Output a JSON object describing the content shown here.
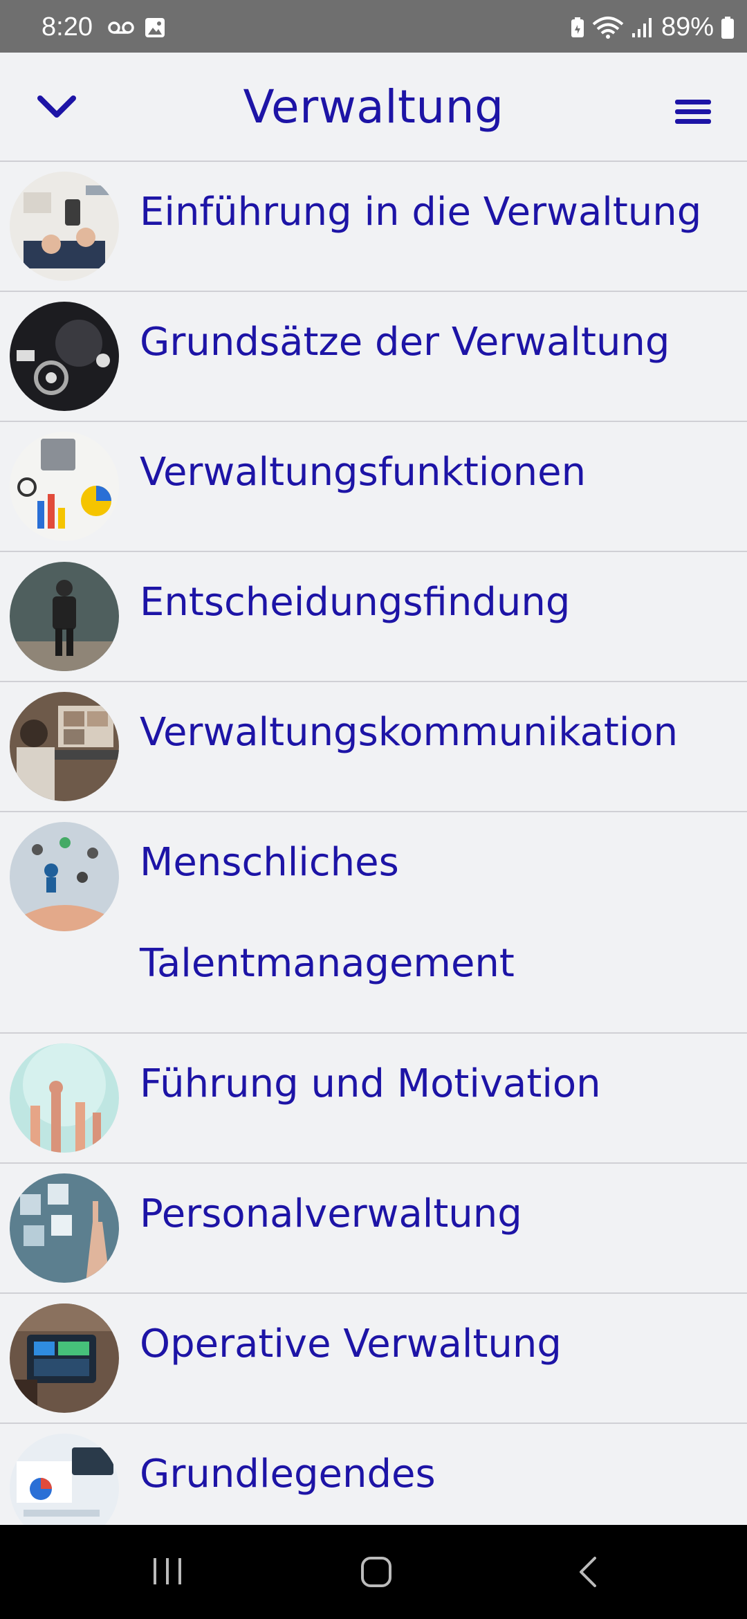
{
  "status_bar": {
    "time": "8:20",
    "battery": "89%",
    "icons": [
      "voicemail-icon",
      "image-icon",
      "battery-saver-icon",
      "wifi-icon",
      "signal-icon",
      "battery-icon"
    ]
  },
  "header": {
    "title": "Verwaltung",
    "left_icon": "chevron-down-icon",
    "right_icon": "hamburger-menu-icon"
  },
  "colors": {
    "accent": "#1d14a6",
    "background": "#f1f2f4",
    "divider": "#d0d0d5"
  },
  "items": [
    {
      "label": "Einführung in die Verwaltung",
      "thumb": "office-desk-photo"
    },
    {
      "label": "Grundsätze der Verwaltung",
      "thumb": "gears-icons-photo"
    },
    {
      "label": "Verwaltungsfunktionen",
      "thumb": "charts-calculator-photo"
    },
    {
      "label": "Entscheidungsfindung",
      "thumb": "man-chalkboard-photo"
    },
    {
      "label": "Verwaltungskommunikation",
      "thumb": "video-call-photo"
    },
    {
      "label": "Menschliches Talentmanagement",
      "thumb": "people-hand-photo"
    },
    {
      "label": "Führung und Motivation",
      "thumb": "raised-hands-photo"
    },
    {
      "label": "Personalverwaltung",
      "thumb": "touchscreen-faces-photo"
    },
    {
      "label": "Operative Verwaltung",
      "thumb": "tablet-warehouse-photo"
    },
    {
      "label": "Grundlegendes",
      "thumb": "documents-charts-photo"
    }
  ],
  "nav_bar": {
    "recent": "recent-apps-icon",
    "home": "home-icon",
    "back": "back-icon"
  }
}
